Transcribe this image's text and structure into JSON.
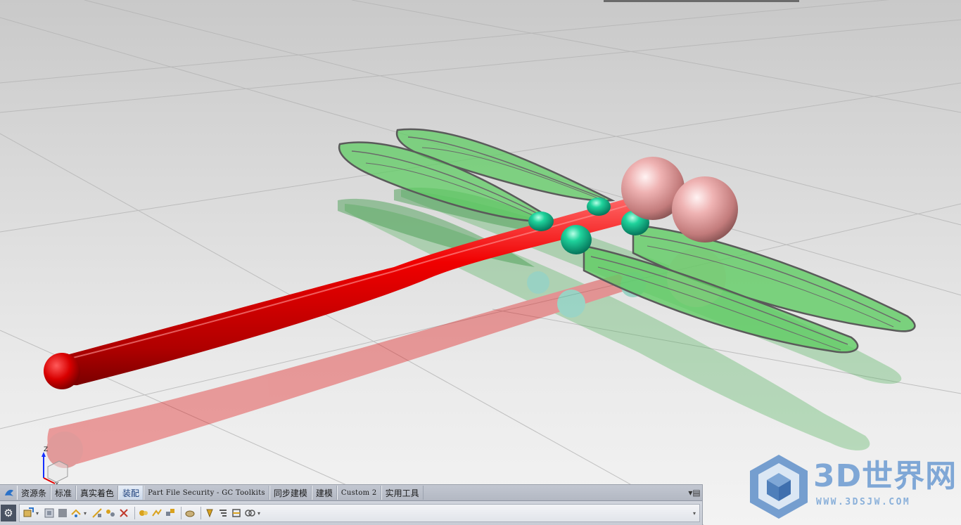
{
  "viewport": {
    "background_top": "#c9c9c9",
    "background_bottom": "#f3f3f3",
    "body_color": "#e00000",
    "wing_color": "#4fc25a",
    "eye_color": "#e8a6a6",
    "joint_color": "#13b58a"
  },
  "triad": {
    "z_label": "Z",
    "x_label": "X"
  },
  "toolbar": {
    "tabs": [
      {
        "label": "资源条"
      },
      {
        "label": "标准"
      },
      {
        "label": "真实着色"
      },
      {
        "label": "装配"
      },
      {
        "label": "Part File Security - GC Toolkits"
      },
      {
        "label": "同步建模"
      },
      {
        "label": "建模"
      },
      {
        "label": "Custom 2"
      },
      {
        "label": "实用工具"
      }
    ],
    "active_tab": "装配",
    "icons": [
      "add-component-icon",
      "assembly-navigator-icon",
      "constraint-icon",
      "move-component-icon",
      "mirror-assembly-icon",
      "explode-view-icon",
      "pattern-component-icon",
      "wave-link-icon",
      "sequence-icon",
      "reference-set-icon",
      "check-clearance-icon",
      "weight-icon",
      "arrangement-icon",
      "product-interface-icon",
      "assembly-cut-icon"
    ]
  },
  "watermark": {
    "title": "3D世界网",
    "url": "WWW.3DSJW.COM",
    "color": "#7fa7d6"
  }
}
